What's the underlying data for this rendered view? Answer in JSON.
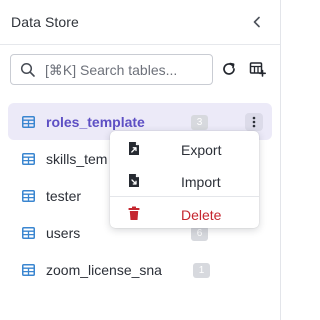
{
  "panel": {
    "title": "Data Store"
  },
  "search": {
    "placeholder": "[⌘K] Search tables..."
  },
  "tables": [
    {
      "name": "roles_template",
      "count": "3",
      "selected": true
    },
    {
      "name": "skills_template",
      "count": ""
    },
    {
      "name": "tester",
      "count": ""
    },
    {
      "name": "users",
      "count": "6"
    },
    {
      "name": "zoom_license_snapshot",
      "count": "1"
    }
  ],
  "row_labels_visible": [
    "roles_template",
    "skills_tem",
    "tester",
    "users",
    "zoom_license_sna"
  ],
  "context_menu": {
    "items": [
      {
        "label": "Export",
        "icon": "export-file-icon"
      },
      {
        "label": "Import",
        "icon": "import-file-icon"
      },
      {
        "label": "Delete",
        "icon": "trash-icon",
        "danger": true
      }
    ]
  },
  "colors": {
    "accent": "#5d4fc4",
    "selected_bg": "#eceaf8",
    "table_icon": "#3a86d0",
    "danger": "#c5262f"
  }
}
